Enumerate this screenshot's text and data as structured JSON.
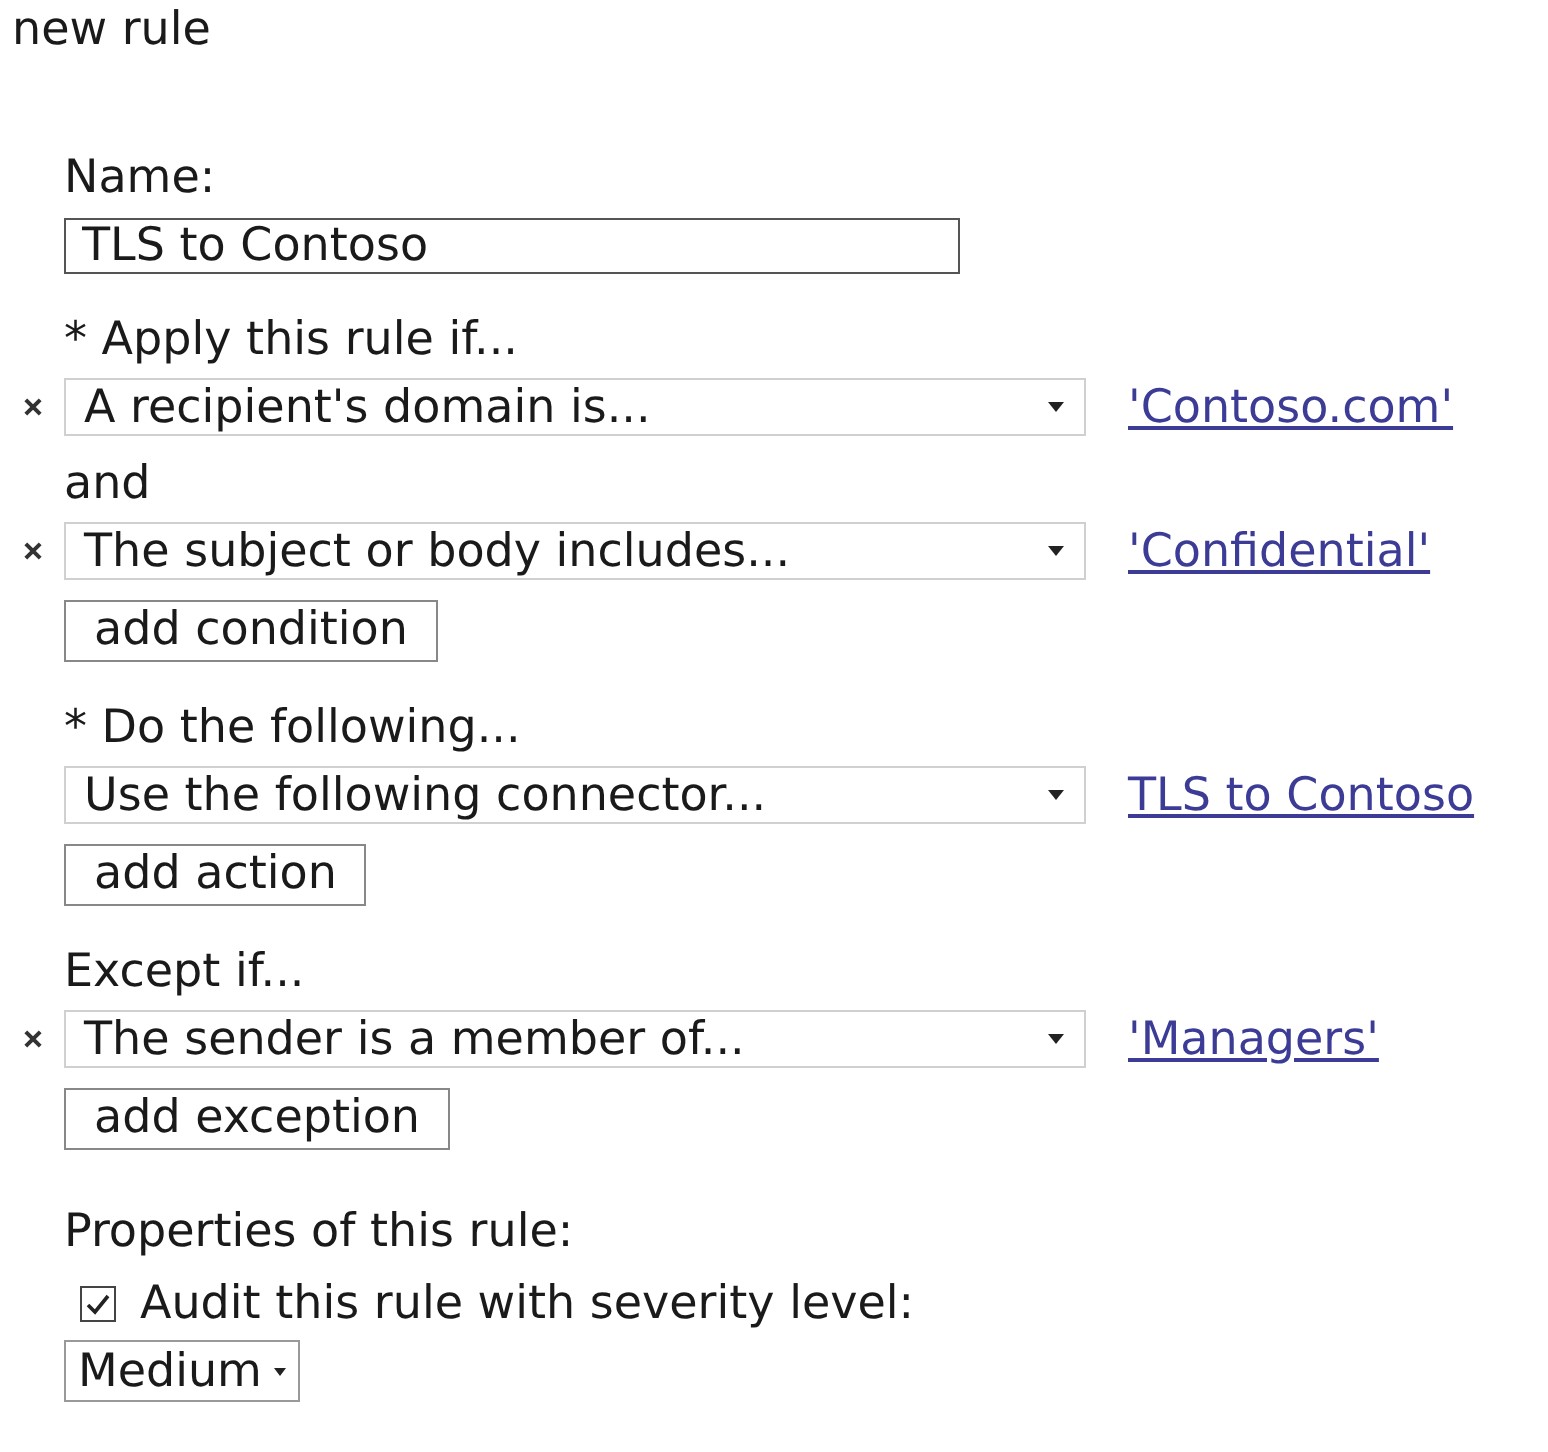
{
  "title": "new rule",
  "name": {
    "label": "Name:",
    "value": "TLS to Contoso"
  },
  "sections": [
    {
      "heading": "* Apply this rule if...",
      "rows": [
        {
          "kind": "rule",
          "removable": true,
          "value": "A recipient's domain is...",
          "link": "'Contoso.com'"
        },
        {
          "kind": "joiner",
          "text": "and"
        },
        {
          "kind": "rule",
          "removable": true,
          "value": "The subject or body includes...",
          "link": "'Confidential'"
        }
      ],
      "add_button": "add condition"
    },
    {
      "heading": "* Do the following...",
      "rows": [
        {
          "kind": "rule",
          "removable": false,
          "value": "Use the following connector...",
          "link": "TLS to Contoso"
        }
      ],
      "add_button": "add action"
    },
    {
      "heading": "Except if...",
      "rows": [
        {
          "kind": "rule",
          "removable": true,
          "value": "The sender is a member of...",
          "link": "'Managers'"
        }
      ],
      "add_button": "add exception"
    }
  ],
  "properties": {
    "heading": "Properties of this rule:",
    "audit": {
      "label": "Audit this rule with severity level:",
      "checked": true
    },
    "severity": "Medium"
  }
}
